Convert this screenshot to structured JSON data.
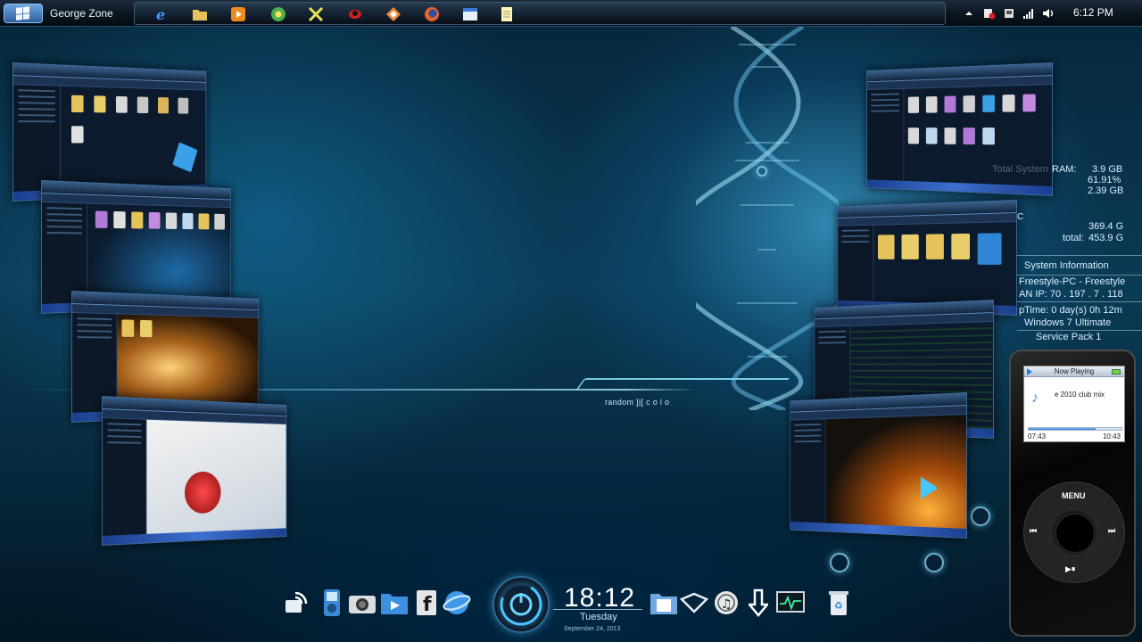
{
  "taskbar": {
    "user_name": "George Zone",
    "clock": "6:12 PM",
    "pinned_icons": [
      "internet-explorer-icon",
      "file-explorer-icon",
      "media-player-icon",
      "chrome-icon",
      "xchat-icon",
      "spider-icon",
      "app-icon",
      "firefox-icon",
      "window-icon",
      "notepad-icon"
    ],
    "tray_icons": [
      "show-hidden-icon",
      "action-center-icon",
      "network-device-icon",
      "signal-icon",
      "volume-icon"
    ]
  },
  "system_info": {
    "ram_label": "RAM:",
    "ram_total_label": "Total System",
    "ram_total": "3.9 GB",
    "ram_percent": "61.91%",
    "ram_used": "2.39 GB",
    "disk_free": "369.4 G",
    "disk_total_label": "total:",
    "disk_total": "453.9 G",
    "drive_letter": "C",
    "header": "System Information",
    "computer": "Freestyle-PC - Freestyle",
    "lan_ip": "AN IP: 70 . 197 . 7 . 118",
    "uptime": "pTime: 0 day(s) 0h 12m",
    "os": "Windows 7 Ultimate",
    "service_pack": "Service Pack 1"
  },
  "ipod": {
    "now_playing": "Now Playing",
    "song": "e 2010 club mix",
    "elapsed": "07:43",
    "total": "10:43",
    "progress": 0.72,
    "menu": "MENU",
    "prev": "⏮",
    "next": "⏭",
    "play_pause": "▶⏸"
  },
  "dock": {
    "time": "18:12",
    "day": "Tuesday",
    "date": "September 24, 2013",
    "icons_left": [
      "rss-icon",
      "ipod-icon",
      "camera-icon",
      "video-folder-icon",
      "facebook-icon",
      "ie-globe-icon"
    ],
    "icons_right": [
      "documents-icon",
      "folders-icon",
      "itunes-icon",
      "download-icon",
      "monitor-icon",
      "recycle-bin-icon"
    ]
  },
  "desktop": {
    "random_label": "random ]|[ c o l o"
  },
  "colors": {
    "accent": "#3fb7ff",
    "taskbar": "#0b1520",
    "ipod_body": "#0b0b0b"
  }
}
